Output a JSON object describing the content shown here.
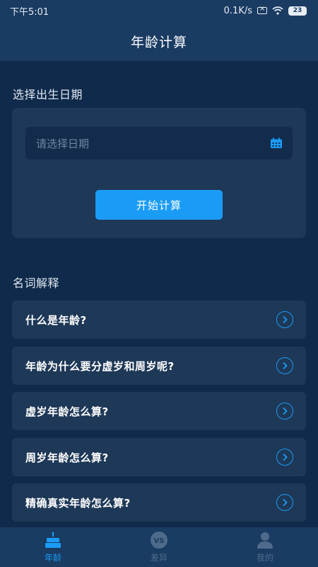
{
  "status_bar": {
    "time": "下午5:01",
    "network_speed": "0.1K/s",
    "battery": "23"
  },
  "app_bar": {
    "title": "年龄计算"
  },
  "birth_section": {
    "title": "选择出生日期",
    "date_placeholder": "请选择日期",
    "start_button": "开始计算"
  },
  "faq_section": {
    "title": "名词解释",
    "items": [
      {
        "label": "什么是年龄?"
      },
      {
        "label": "年龄为什么要分虚岁和周岁呢?"
      },
      {
        "label": "虚岁年龄怎么算?"
      },
      {
        "label": "周岁年龄怎么算?"
      },
      {
        "label": "精确真实年龄怎么算?"
      }
    ]
  },
  "bottom_nav": {
    "items": [
      {
        "label": "年龄",
        "icon": "cake-icon",
        "active": true
      },
      {
        "label": "差异",
        "icon": "vs-icon",
        "active": false
      },
      {
        "label": "我的",
        "icon": "user-icon",
        "active": false
      }
    ]
  },
  "colors": {
    "background": "#0f2a4a",
    "bar": "#1a3b62",
    "card": "#1e3857",
    "accent": "#1a9cf6"
  }
}
